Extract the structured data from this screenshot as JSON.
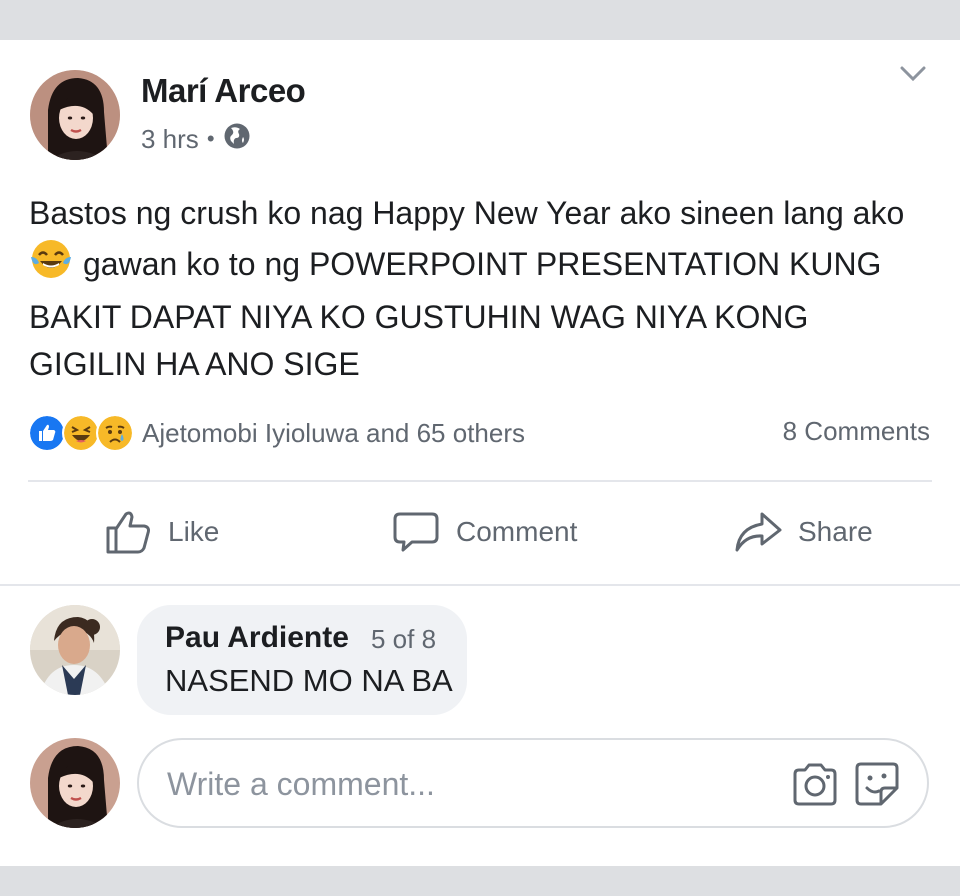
{
  "post": {
    "author_name": "Marí Arceo",
    "time": "3 hrs",
    "separator": "•",
    "privacy_icon": "globe-icon",
    "text_before_emoji": "Bastos ng crush ko nag Happy New Year ako sineen lang ako",
    "emoji": "tears-of-joy-emoji",
    "text_after_emoji": "gawan ko to ng POWERPOINT PRESENTATION KUNG BAKIT DAPAT NIYA KO GUSTUHIN WAG NIYA KONG GIGILIN HA ANO SIGE",
    "reactions": [
      "like",
      "haha",
      "sad"
    ],
    "reaction_summary": "Ajetomobi Iyioluwa and 65 others",
    "comment_count": "8 Comments"
  },
  "actions": {
    "like_label": "Like",
    "comment_label": "Comment",
    "share_label": "Share"
  },
  "comment": {
    "name": "Pau Ardiente",
    "position": "5 of 8",
    "text": "NASEND MO NA BA"
  },
  "composer": {
    "placeholder": "Write a comment..."
  },
  "colors": {
    "like_blue": "#1877f2",
    "emoji_yellow": "#f7b928",
    "secondary_text": "#606770",
    "background": "#dddfe2"
  }
}
